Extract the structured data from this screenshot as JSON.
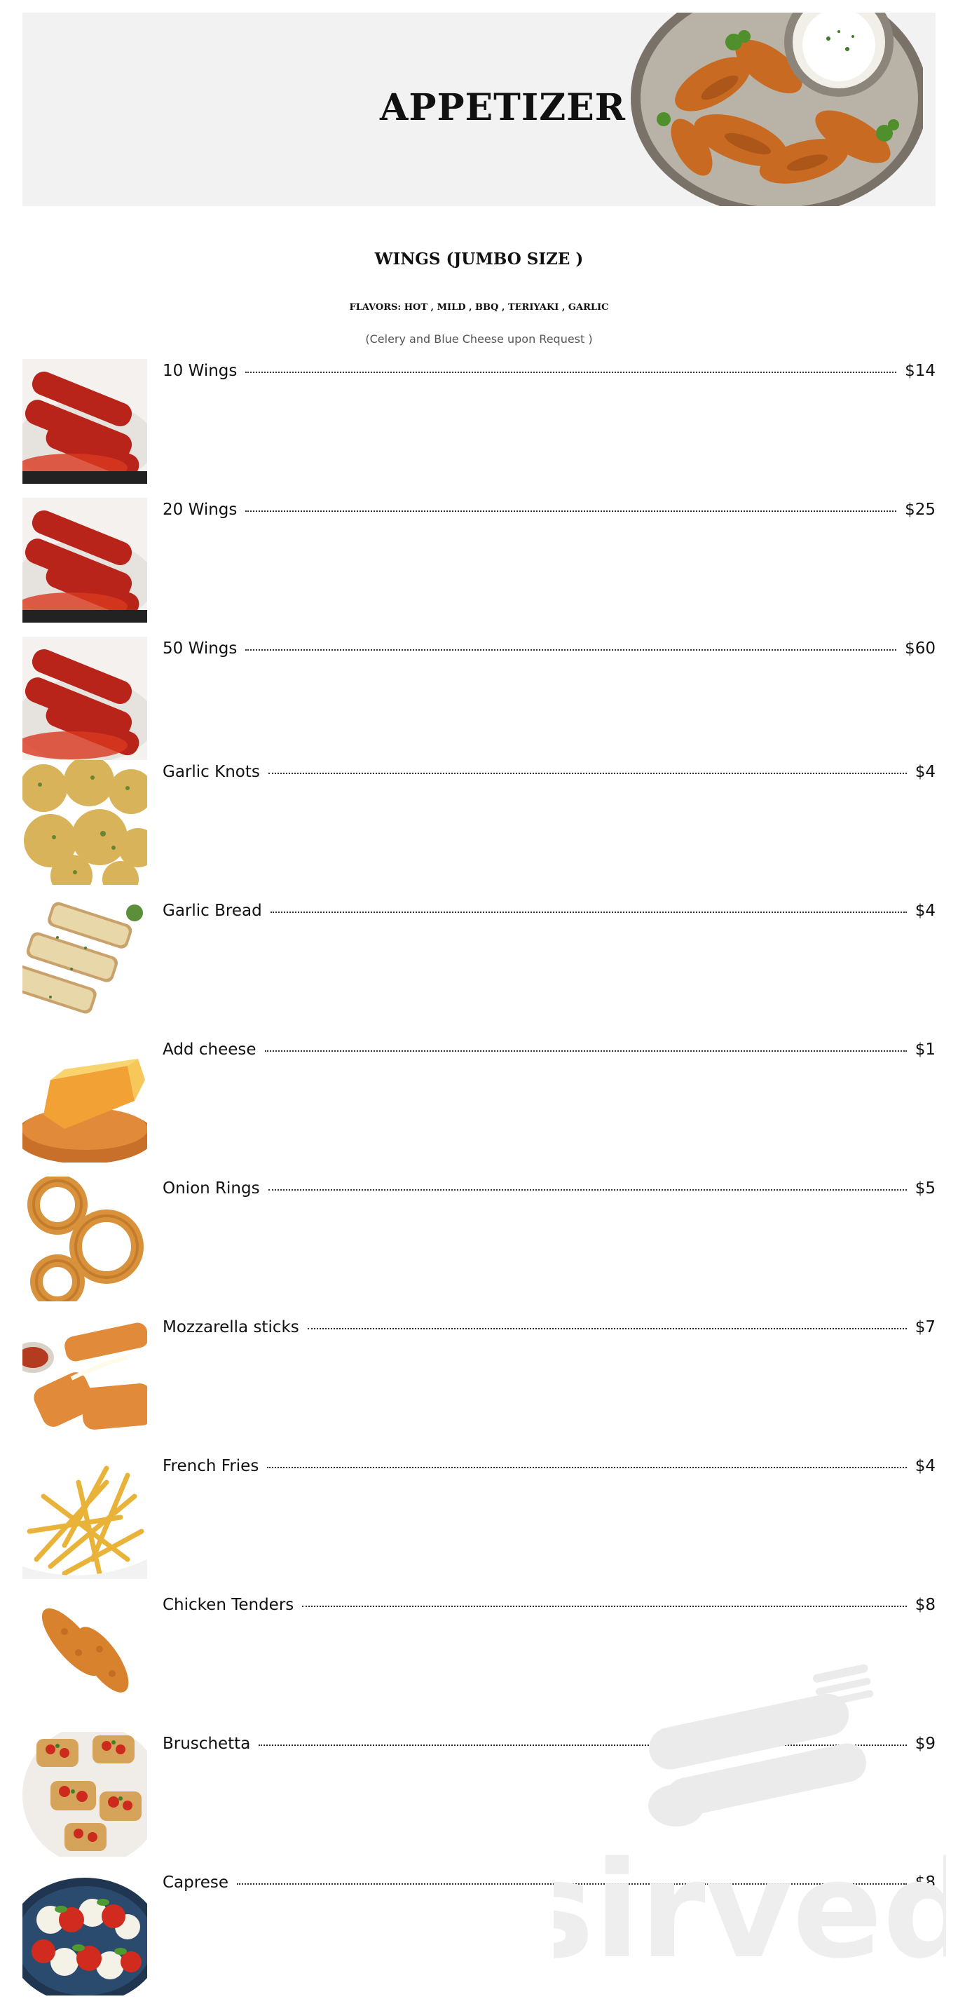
{
  "header": {
    "title": "APPETIZER"
  },
  "section": {
    "title": "WINGS (JUMBO SIZE )",
    "flavors": "FLAVORS: HOT , MILD , BBQ , TERIYAKI , GARLIC",
    "note": "(Celery and Blue Cheese upon Request )"
  },
  "items": [
    {
      "name": "10 Wings",
      "price": "$14",
      "icon": "wings-photo"
    },
    {
      "name": "20 Wings",
      "price": "$25",
      "icon": "wings-photo"
    },
    {
      "name": "50 Wings",
      "price": "$60",
      "icon": "wings-photo"
    },
    {
      "name": "Garlic Knots",
      "price": "$4",
      "icon": "garlic-knots-photo"
    },
    {
      "name": "Garlic Bread",
      "price": "$4",
      "icon": "garlic-bread-photo"
    },
    {
      "name": "Add cheese",
      "price": "$1",
      "icon": "cheese-photo"
    },
    {
      "name": "Onion Rings",
      "price": "$5",
      "icon": "onion-rings-photo"
    },
    {
      "name": "Mozzarella sticks",
      "price": "$7",
      "icon": "mozzarella-sticks-photo"
    },
    {
      "name": "French Fries",
      "price": "$4",
      "icon": "french-fries-photo"
    },
    {
      "name": "Chicken Tenders",
      "price": "$8",
      "icon": "chicken-tenders-photo"
    },
    {
      "name": "Bruschetta",
      "price": "$9",
      "icon": "bruschetta-photo"
    },
    {
      "name": "Caprese",
      "price": "$8",
      "icon": "caprese-photo"
    }
  ],
  "watermark": {
    "text": "sirved"
  }
}
